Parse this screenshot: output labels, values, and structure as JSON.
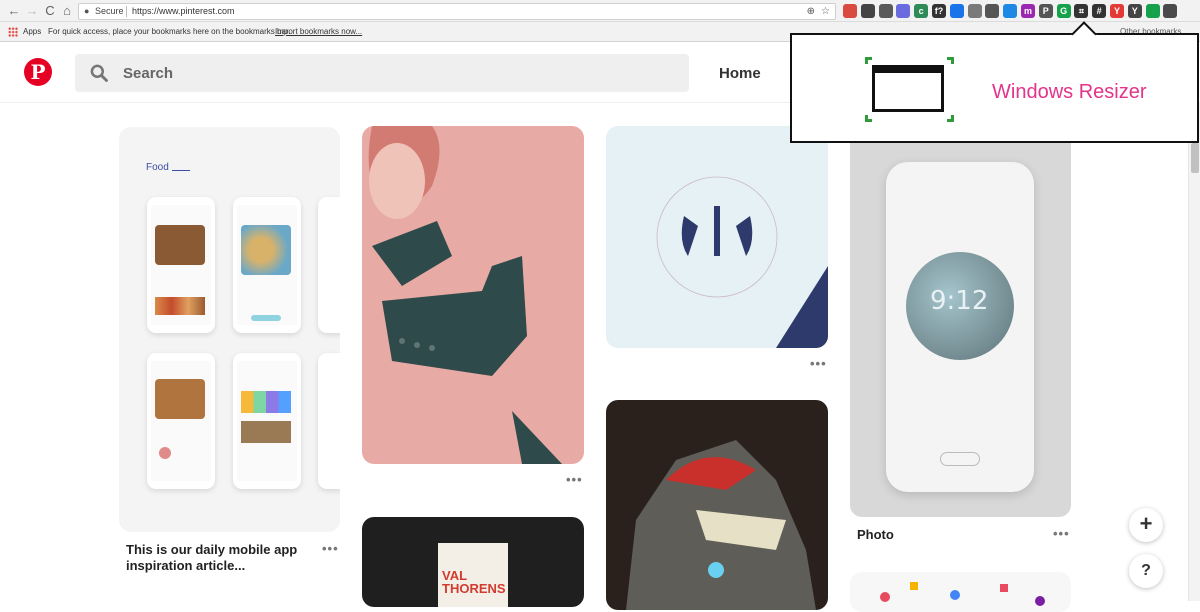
{
  "browser": {
    "nav": {
      "back": "←",
      "forward": "→",
      "reload": "C",
      "home": "⌂"
    },
    "omnibox": {
      "lock": "🔒",
      "secure_label": "Secure",
      "url": "https://www.pinterest.com",
      "zoom": "⊕",
      "star": "☆"
    },
    "extensions": [
      "ext-a",
      "ext-b",
      "ext-c",
      "ext-d",
      "ext-e",
      "ext-f",
      "ext-g",
      "ext-h",
      "ext-i",
      "ext-j",
      "ext-k",
      "ext-l",
      "ext-m",
      "ext-n",
      "ext-o",
      "ext-p",
      "ext-q",
      "ext-r",
      "ext-s"
    ],
    "extension_glyphs": [
      "",
      "",
      "",
      "",
      "c",
      "f?",
      "",
      "",
      "",
      "",
      "m",
      "P",
      "G",
      "⌗",
      "#",
      "Y",
      "Y",
      "",
      ""
    ],
    "extension_colors": [
      "#d94b3e",
      "#444444",
      "#5a5a5a",
      "#6b6be0",
      "#2e8b57",
      "#333333",
      "#1a73e8",
      "#7a7a7a",
      "#555555",
      "#1e88e5",
      "#9c27b0",
      "#555555",
      "#15a24a",
      "#333333",
      "#333333",
      "#e53935",
      "#444444",
      "#15a24a",
      "#4a4a4a"
    ],
    "bookmarks": {
      "apps_label": "Apps",
      "hint": "For quick access, place your bookmarks here on the bookmarks bar.",
      "import_link": "Import bookmarks now...",
      "other": "Other bookmarks"
    }
  },
  "pinterest": {
    "logo": "P",
    "search_placeholder": "Search",
    "nav_home": "Home"
  },
  "resizer_popup": {
    "title": "Windows Resizer"
  },
  "pins": [
    {
      "caption": "This is our daily mobile app inspiration article...",
      "more": "•••",
      "inner_label": "Food"
    },
    {
      "more": "•••"
    },
    {
      "more": "•••"
    },
    {
      "caption": "Photo",
      "more": "•••",
      "clock": "9:12"
    },
    {
      "poster_text": "VAL THORENS"
    }
  ],
  "fabs": {
    "add": "+",
    "help": "?"
  },
  "colors": {
    "brand": "#e60023",
    "resizer_accent": "#e3338a"
  }
}
